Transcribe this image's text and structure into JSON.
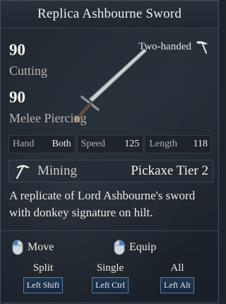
{
  "tooltip": {
    "title": "Replica Ashbourne Sword",
    "handedness": "Two-handed",
    "stats": [
      {
        "value": "90",
        "label": "Cutting"
      },
      {
        "value": "90",
        "label": "Melee Piercing"
      }
    ],
    "attributes": [
      {
        "key": "Hand",
        "value": "Both"
      },
      {
        "key": "Speed",
        "value": "125"
      },
      {
        "key": "Length",
        "value": "118"
      }
    ],
    "skill": {
      "name": "Mining",
      "tier": "Pickaxe Tier 2"
    },
    "description": "A replicate of Lord Ashbourne's sword with donkey signature on hilt.",
    "mouse_actions": [
      {
        "label": "Move",
        "icon": "mouse-left-icon"
      },
      {
        "label": "Equip",
        "icon": "mouse-right-icon"
      }
    ],
    "keys": [
      {
        "action": "Split",
        "key": "Left Shift"
      },
      {
        "action": "Single",
        "key": "Left Ctrl"
      },
      {
        "action": "All",
        "key": "Left Alt"
      }
    ]
  },
  "colors": {
    "background": "#1f262d",
    "key_border": "#5a7da6",
    "mouse_accent": "#3a7fd0"
  }
}
